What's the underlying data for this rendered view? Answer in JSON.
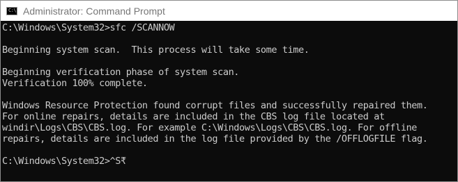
{
  "window": {
    "title": "Administrator: Command Prompt",
    "icon": "command-prompt-icon",
    "icon_text": "C:\\"
  },
  "console": {
    "lines": [
      "C:\\Windows\\System32>sfc /SCANNOW",
      "Beginning system scan.  This process will take some time.",
      "Beginning verification phase of system scan.",
      "Verification 100% complete.",
      "Windows Resource Protection found corrupt files and successfully repaired them.",
      "For online repairs, details are included in the CBS log file located at",
      "windir\\Logs\\CBS\\CBS.log. For example C:\\Windows\\Logs\\CBS\\CBS.log. For offline",
      "repairs, details are included in the log file provided by the /OFFLOGFILE flag.",
      "C:\\Windows\\System32>^S₹"
    ],
    "colors": {
      "background": "#0c0c0c",
      "text": "#cccccc"
    }
  }
}
